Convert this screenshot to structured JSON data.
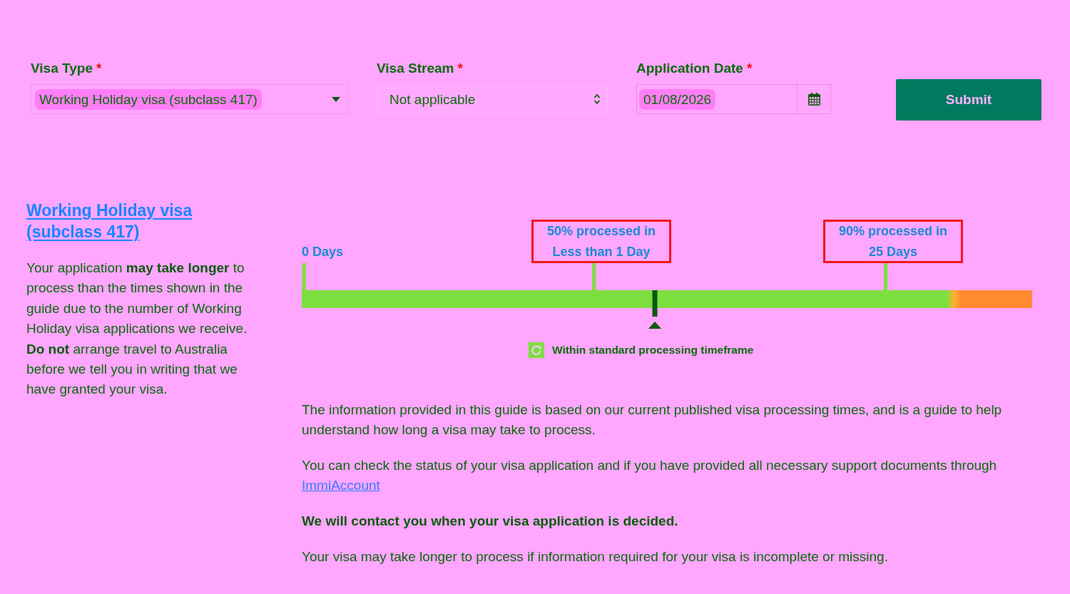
{
  "form": {
    "fields": [
      {
        "kind": "dropdown",
        "label": "Visa Type",
        "required_mark": "*",
        "value": "Working Holiday visa (subclass 417)",
        "highlighted": true
      },
      {
        "kind": "spinner",
        "label": "Visa Stream",
        "required_mark": "*",
        "value": "Not applicable",
        "highlighted": false
      },
      {
        "kind": "date",
        "label": "Application Date",
        "required_mark": "*",
        "value": "01/08/2026",
        "highlighted": true
      }
    ],
    "submit": "Submit"
  },
  "guide": {
    "title": "Working Holiday visa (subclass 417)",
    "note": "Your application **may take longer** to process than the times shown in the guide due to the number of Working Holiday visa applications we receive. **Do not** arrange travel to Australia before we tell you in writing that we have granted your visa."
  },
  "timeline": {
    "start_label": "0 Days",
    "milestones": [
      {
        "share": "50% processed in",
        "time": "Less than 1 Day"
      },
      {
        "share": "90% processed in",
        "time": "25 Days"
      }
    ],
    "marker": {
      "level": 0.483
    },
    "status": {
      "kind": "within",
      "text": "Within standard processing timeframe"
    }
  },
  "info": [
    {
      "kind": "plain",
      "text": "The information provided in this guide is based on our current published visa processing times, and is a guide to help understand how long a visa may take to process."
    },
    {
      "kind": "plain",
      "text": "You can check the status of your visa application and if you have provided all necessary support documents through",
      "link": "ImmiAccount"
    },
    {
      "kind": "bold",
      "text": "We will contact you when your visa application is decided."
    },
    {
      "kind": "plain",
      "text": "Your visa may take longer to process if information required for your visa is incomplete or missing."
    }
  ]
}
